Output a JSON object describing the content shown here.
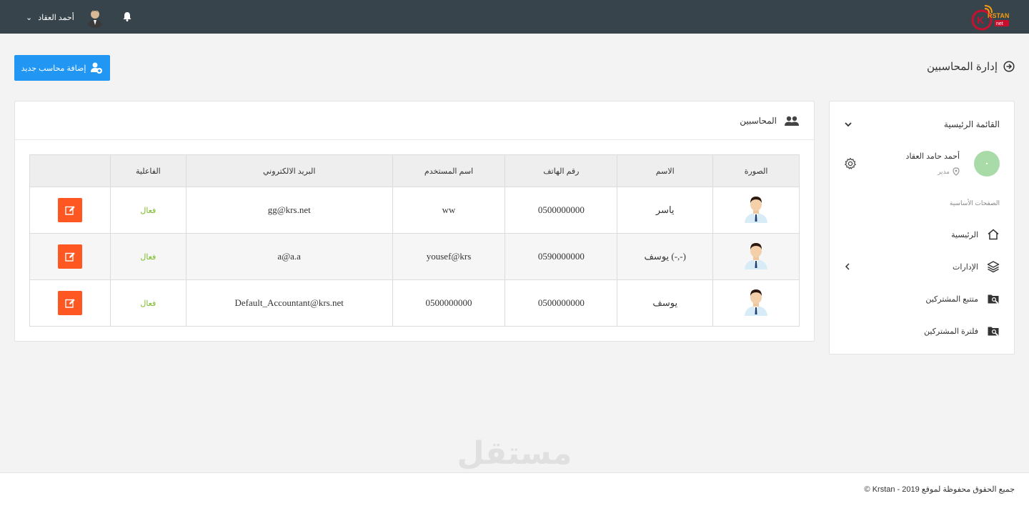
{
  "topbar": {
    "user_name": "أحمد العقاد",
    "logo_text": "RSTAN",
    "logo_sub": "net"
  },
  "page": {
    "title": "إدارة المحاسبين",
    "add_button": "إضافة محاسب جديد"
  },
  "panel": {
    "title": "المحاسبين",
    "columns": [
      "الصورة",
      "الاسم",
      "رقم الهاتف",
      "اسم المستخدم",
      "البريد الالكتروني",
      "الفاعلية",
      ""
    ],
    "rows": [
      {
        "name": "ياسر",
        "phone": "0500000000",
        "username": "ww",
        "email": "gg@krs.net",
        "status": "فعال"
      },
      {
        "name": "(-,-) يوسف",
        "phone": "0590000000",
        "username": "yousef@krs",
        "email": "a@a.a",
        "status": "فعال"
      },
      {
        "name": "يوسف",
        "phone": "0500000000",
        "username": "0500000000",
        "email": "Default_Accountant@krs.net",
        "status": "فعال"
      }
    ]
  },
  "sidebar": {
    "menu_title": "القائمة الرئيسية",
    "user_name": "أحمد حامد العقاد",
    "user_role": "مدير",
    "section_label": "الصفحات الأساسية",
    "items": [
      {
        "label": "الرئيسية",
        "icon": "home-icon"
      },
      {
        "label": "الإدارات",
        "icon": "layers-icon"
      },
      {
        "label": "متتبع المشتركين",
        "icon": "folder-search-icon"
      },
      {
        "label": "فلترة المشتركين",
        "icon": "folder-search-icon"
      }
    ]
  },
  "footer": {
    "copyright": "جميع الحقوق محفوظة لموقع 2019 - Krstan ©"
  },
  "watermark": {
    "arabic": "مستقل",
    "latin": "mostaql.com"
  },
  "colors": {
    "topbar": "#37444c",
    "primary": "#2196f3",
    "danger": "#ff5722",
    "success": "#7cbb28"
  }
}
